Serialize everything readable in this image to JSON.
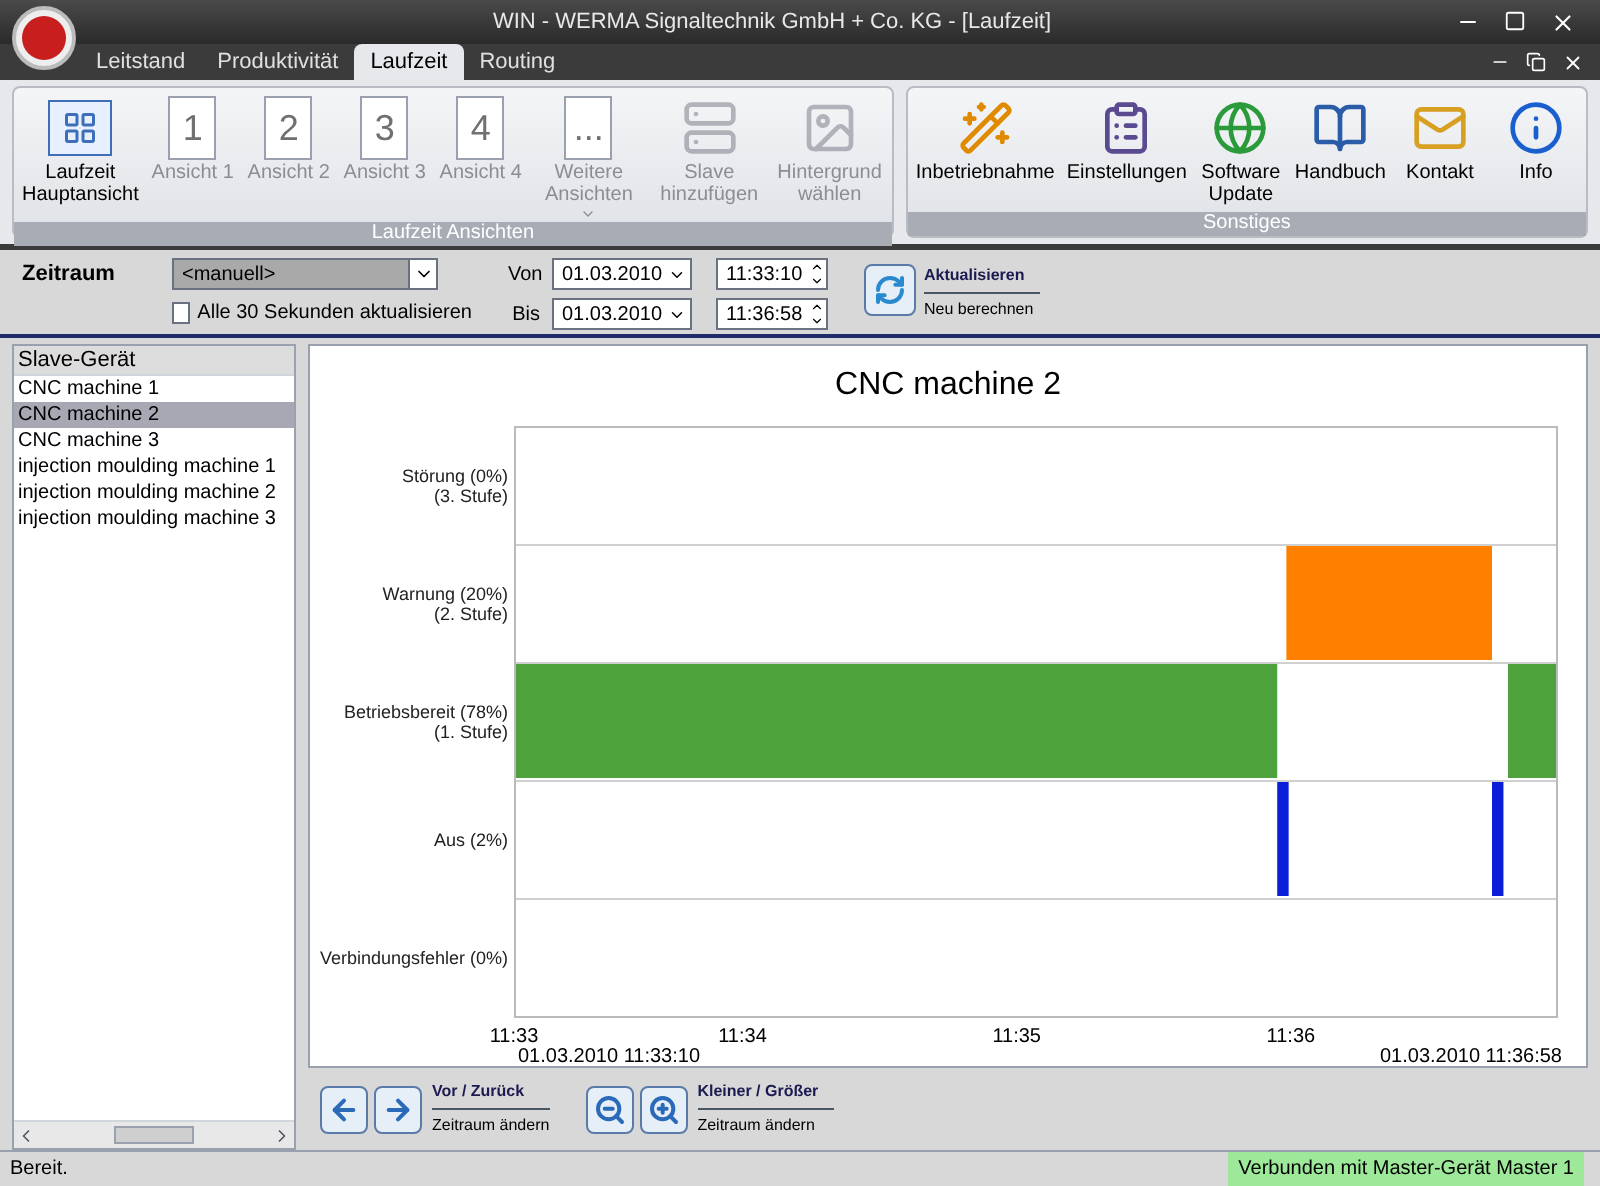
{
  "window": {
    "title": "WIN - WERMA Signaltechnik GmbH + Co. KG - [Laufzeit]"
  },
  "tabs": [
    {
      "label": "Leitstand",
      "selected": false
    },
    {
      "label": "Produktivität",
      "selected": false
    },
    {
      "label": "Laufzeit",
      "selected": true
    },
    {
      "label": "Routing",
      "selected": false
    }
  ],
  "ribbon": {
    "groups": [
      {
        "title": "Laufzeit Ansichten",
        "items": [
          {
            "kind": "calendar",
            "label": "Laufzeit Hauptansicht",
            "disabled": false
          },
          {
            "kind": "page",
            "icon_text": "1",
            "label": "Ansicht 1",
            "disabled": true
          },
          {
            "kind": "page",
            "icon_text": "2",
            "label": "Ansicht 2",
            "disabled": true
          },
          {
            "kind": "page",
            "icon_text": "3",
            "label": "Ansicht 3",
            "disabled": true
          },
          {
            "kind": "page",
            "icon_text": "4",
            "label": "Ansicht 4",
            "disabled": true
          },
          {
            "kind": "page",
            "icon_text": "...",
            "label": "Weitere Ansichten",
            "disabled": true,
            "dropdown": true
          },
          {
            "kind": "slave",
            "label": "Slave hinzufügen",
            "disabled": true
          },
          {
            "kind": "image",
            "label": "Hintergrund wählen",
            "disabled": true
          }
        ]
      },
      {
        "title": "Sonstiges",
        "items": [
          {
            "kind": "wand",
            "label": "Inbetriebnahme",
            "disabled": false
          },
          {
            "kind": "clipboard",
            "label": "Einstellungen",
            "disabled": false
          },
          {
            "kind": "globe",
            "label": "Software Update",
            "disabled": false
          },
          {
            "kind": "book",
            "label": "Handbuch",
            "disabled": false
          },
          {
            "kind": "mail",
            "label": "Kontakt",
            "disabled": false
          },
          {
            "kind": "info",
            "label": "Info",
            "disabled": false
          }
        ]
      }
    ]
  },
  "filter": {
    "label": "Zeitraum",
    "range": "<manuell>",
    "auto_refresh": {
      "label": "Alle 30 Sekunden aktualisieren",
      "checked": false
    },
    "from": {
      "label": "Von",
      "date": "01.03.2010",
      "time": "11:33:10"
    },
    "to": {
      "label": "Bis",
      "date": "01.03.2010",
      "time": "11:36:58"
    },
    "refresh": {
      "title": "Aktualisieren",
      "subtitle": "Neu berechnen"
    }
  },
  "sidebar": {
    "header": "Slave-Gerät",
    "items": [
      {
        "label": "CNC machine 1",
        "selected": false
      },
      {
        "label": "CNC machine 2",
        "selected": true
      },
      {
        "label": "CNC machine 3",
        "selected": false
      },
      {
        "label": "injection moulding machine 1",
        "selected": false
      },
      {
        "label": "injection moulding machine 2",
        "selected": false
      },
      {
        "label": "injection moulding machine 3",
        "selected": false
      }
    ]
  },
  "chart": {
    "title": "CNC machine 2",
    "start_label": "01.03.2010 11:33:10",
    "end_label": "01.03.2010 11:36:58",
    "rows": [
      "Störung (0%)\n(3. Stufe)",
      "Warnung (20%)\n(2. Stufe)",
      "Betriebsbereit (78%)\n(1. Stufe)",
      "Aus (2%)",
      "Verbindungsfehler (0%)"
    ],
    "tick_labels": [
      "11:33",
      "11:34",
      "11:35",
      "11:36"
    ]
  },
  "nav": [
    {
      "title": "Vor / Zurück",
      "subtitle": "Zeitraum ändern",
      "buttons": [
        {
          "kind": "back"
        },
        {
          "kind": "forward"
        }
      ]
    },
    {
      "title": "Kleiner / Größer",
      "subtitle": "Zeitraum ändern",
      "buttons": [
        {
          "kind": "zoom-out"
        },
        {
          "kind": "zoom-in"
        }
      ]
    }
  ],
  "status_bar": {
    "left": "Bereit.",
    "right": "Verbunden mit Master-Gerät Master 1"
  }
}
